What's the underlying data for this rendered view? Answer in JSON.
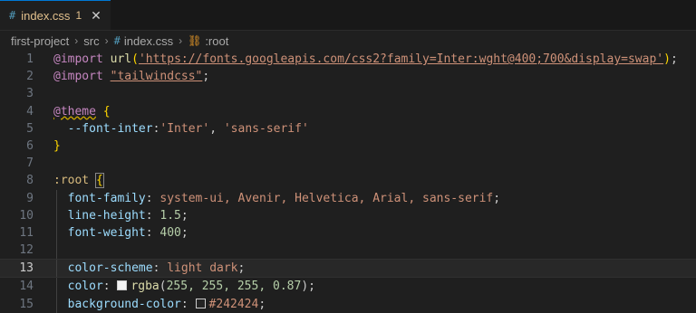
{
  "tab": {
    "icon": "css-hash-icon",
    "filename": "index.css",
    "problems": "1",
    "close": "✕"
  },
  "breadcrumb": {
    "items": [
      "first-project",
      "src",
      "index.css",
      ":root"
    ]
  },
  "lines": [
    {
      "n": "1"
    },
    {
      "n": "2"
    },
    {
      "n": "3"
    },
    {
      "n": "4"
    },
    {
      "n": "5"
    },
    {
      "n": "6"
    },
    {
      "n": "7"
    },
    {
      "n": "8"
    },
    {
      "n": "9"
    },
    {
      "n": "10"
    },
    {
      "n": "11"
    },
    {
      "n": "12"
    },
    {
      "n": "13"
    },
    {
      "n": "14"
    },
    {
      "n": "15"
    }
  ],
  "code": {
    "l1_at": "@import",
    "l1_fn": "url",
    "l1_str": "'https://fonts.googleapis.com/css2?family=Inter:wght@400;700&display=swap'",
    "l2_at": "@import",
    "l2_str": "\"tailwindcss\"",
    "l4_at": "@theme",
    "l5_prop": "--font-inter",
    "l5_str1": "'Inter'",
    "l5_str2": "'sans-serif'",
    "l8_sel": ":root",
    "l9_prop": "font-family",
    "l9_val": "system-ui, Avenir, Helvetica, Arial, sans-serif",
    "l10_prop": "line-height",
    "l10_val": "1.5",
    "l11_prop": "font-weight",
    "l11_val": "400",
    "l13_prop": "color-scheme",
    "l13_val": "light dark",
    "l14_prop": "color",
    "l14_fn": "rgba",
    "l14_args": "255, 255, 255, 0.87",
    "l15_prop": "background-color",
    "l15_val": "#242424"
  },
  "colors": {
    "swatch14": "#f2f2f2",
    "swatch15": "#242424"
  },
  "active_line": "13"
}
